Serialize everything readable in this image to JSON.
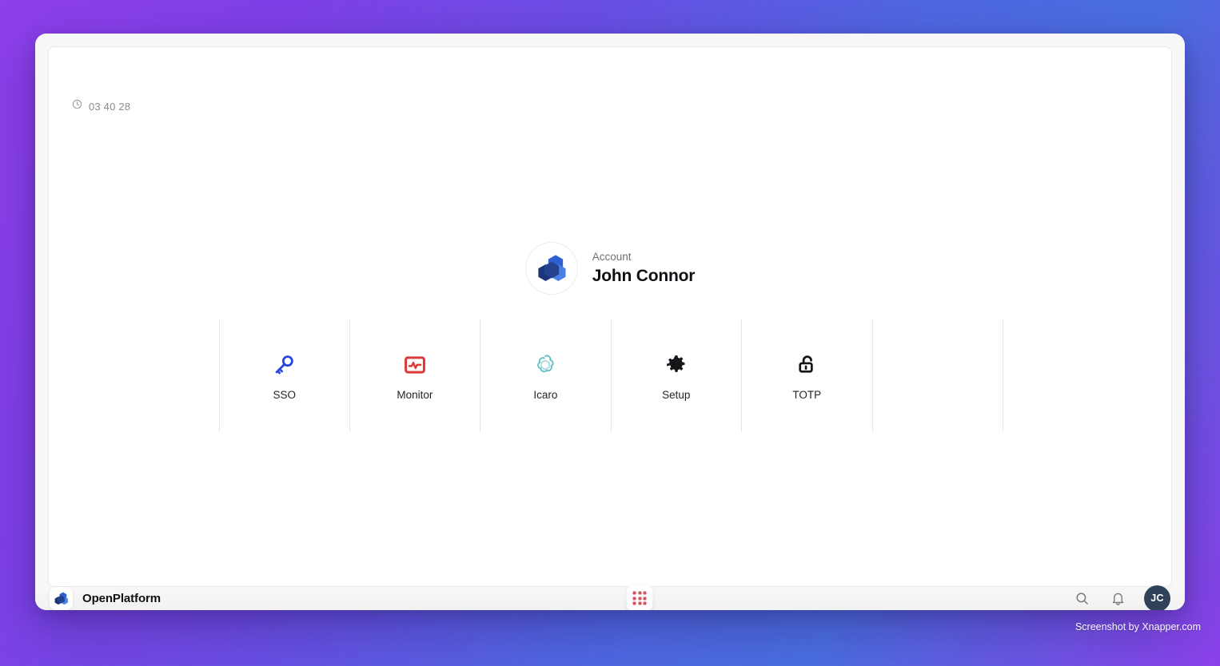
{
  "watermark": "Screenshot by Xnapper.com",
  "window": {
    "clock": {
      "icon": "clock-icon",
      "time": "03 40 28"
    },
    "account": {
      "label": "Account",
      "name": "John Connor",
      "avatar_icon": "openplatform-cubes-logo"
    },
    "apps": [
      {
        "label": "SSO",
        "icon": "key-icon",
        "color": "#2b45e0"
      },
      {
        "label": "Monitor",
        "icon": "pulse-icon",
        "color": "#dc3a3a"
      },
      {
        "label": "Icaro",
        "icon": "openai-knot-icon",
        "color": "#5fbfc4"
      },
      {
        "label": "Setup",
        "icon": "gear-icon",
        "color": "#16161a"
      },
      {
        "label": "TOTP",
        "icon": "unlock-icon",
        "color": "#16161a"
      }
    ]
  },
  "taskbar": {
    "brand": {
      "name": "OpenPlatform",
      "icon": "openplatform-cubes-logo"
    },
    "grid_button": {
      "icon": "app-grid-icon",
      "dot_color": "#d3535f"
    },
    "actions": [
      {
        "icon": "search-icon"
      },
      {
        "icon": "bell-icon"
      }
    ],
    "user": {
      "initials": "JC",
      "bg": "#2f4259"
    }
  },
  "theme": {
    "gradient_start": "#8d3fe9",
    "gradient_mid": "#4a6ee0",
    "gradient_end": "#8b40e8",
    "panel_bg": "#ffffff",
    "shell_bg": "#f7f7f7",
    "divider": "#e9e9ec"
  }
}
